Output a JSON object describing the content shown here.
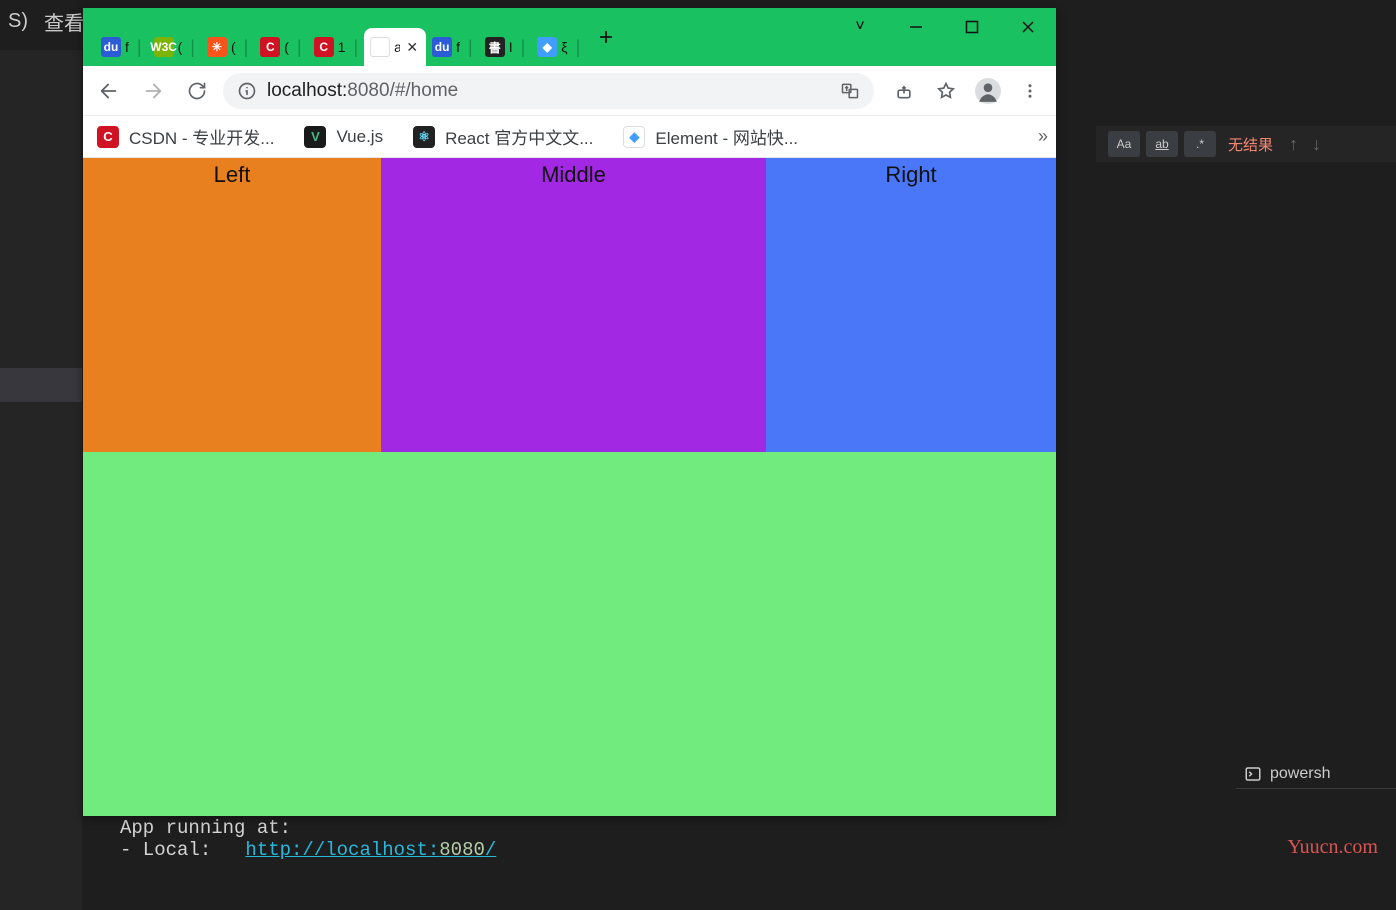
{
  "ide": {
    "menu_item": "查看",
    "menu_prefix": "S)",
    "sidebar_search_no_result": "无结果",
    "rp_Aa": "Aa",
    "rp_ab": "ab",
    "rp_dotstar": ".*"
  },
  "browser": {
    "win": {
      "chevron": "˅"
    },
    "tabs": [
      {
        "letter": "f",
        "fav_bg": "#2b5cd6",
        "fav_txt": "du"
      },
      {
        "letter": "(",
        "fav_bg": "#7cb305",
        "fav_txt": "W3C"
      },
      {
        "letter": "(",
        "fav_bg": "#fa541c",
        "fav_txt": "✳"
      },
      {
        "letter": "(",
        "fav_bg": "#cf1322",
        "fav_txt": "C"
      },
      {
        "letter": "1",
        "fav_bg": "#cf1322",
        "fav_txt": "C"
      },
      {
        "letter": "a",
        "fav_bg": "#ffffff",
        "fav_txt": "",
        "active": true
      },
      {
        "letter": "f",
        "fav_bg": "#2b5cd6",
        "fav_txt": "du"
      },
      {
        "letter": "I",
        "fav_bg": "#222222",
        "fav_txt": "書"
      },
      {
        "letter": "ξ",
        "fav_bg": "#409eff",
        "fav_txt": "◆"
      }
    ],
    "addr": {
      "host": "localhost:",
      "port": "8080",
      "path": "/#/home"
    },
    "bookmarks": [
      {
        "label": "CSDN - 专业开发...",
        "bic_bg": "#cf1322",
        "bic_txt": "C"
      },
      {
        "label": "Vue.js",
        "bic_bg": "#1a1a1a",
        "bic_txt": "V",
        "bic_color": "#41b883"
      },
      {
        "label": "React 官方中文文...",
        "bic_bg": "#222222",
        "bic_txt": "⚛",
        "bic_color": "#61dafb"
      },
      {
        "label": "Element - 网站快...",
        "bic_bg": "#ffffff",
        "bic_txt": "◆",
        "bic_color": "#409eff"
      }
    ]
  },
  "page": {
    "left": "Left",
    "middle": "Middle",
    "right": "Right"
  },
  "terminal": {
    "shell": "powersh",
    "line1": "App running at:",
    "line2a": "- Local:   ",
    "line2b": "http://localhost:",
    "line2c": "8080",
    "line2d": "/"
  },
  "watermark": "Yuucn.com"
}
